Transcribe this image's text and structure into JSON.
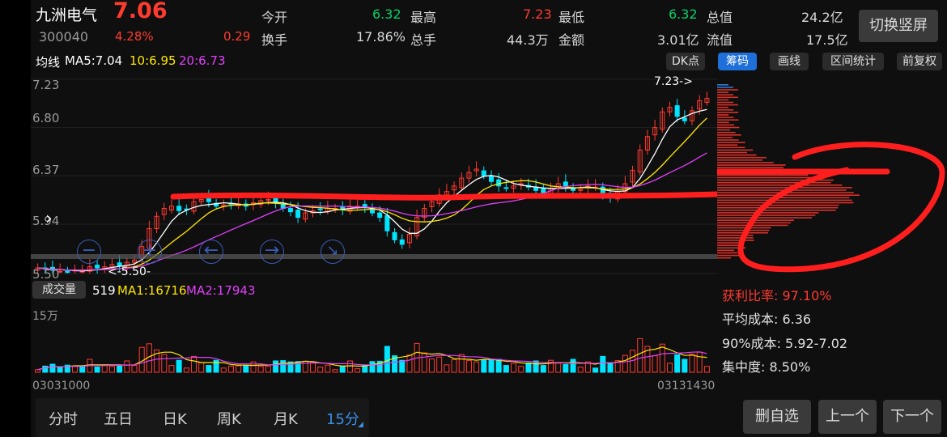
{
  "header": {
    "stock_name": "九洲电气",
    "price": "7.06",
    "code": "300040",
    "change_pct": "4.28%",
    "change_amt": "0.29",
    "open_label": "今开",
    "open_value": "6.32",
    "high_label": "最高",
    "high_value": "7.23",
    "low_label": "最低",
    "low_value": "6.32",
    "mktcap_label": "总值",
    "mktcap_value": "24.2亿",
    "turnover_label": "换手",
    "turnover_value": "17.86%",
    "volume_label": "总手",
    "volume_value": "44.3万",
    "amount_label": "金额",
    "amount_value": "3.01亿",
    "float_label": "流值",
    "float_value": "17.5亿",
    "switch_label": "切换竖屏"
  },
  "ma_bar": {
    "label": "均线",
    "ma5": "MA5:7.04",
    "ma10": "10:6.95",
    "ma20": "20:6.73"
  },
  "toolbar": {
    "dk": "DK点",
    "chip": "筹码",
    "draw": "画线",
    "interval": "区间统计",
    "restore": "前复权"
  },
  "price_axis": [
    "7.23",
    "6.80",
    "6.37",
    "5.94",
    "5.50"
  ],
  "annotations": {
    "high_marker": "7.23->",
    "low_marker": "<-5.50-"
  },
  "volume_bar": {
    "button": "成交量",
    "value": "519",
    "ma1": "MA1:16716",
    "ma2": "MA2:17943",
    "axis_max": "15万"
  },
  "time_axis": {
    "start": "03031000",
    "end": "03131430"
  },
  "chip_stats": {
    "profit_ratio": "获利比率: 97.10%",
    "avg_cost": "平均成本: 6.36",
    "cost90": "90%成本: 5.92-7.02",
    "concentration": "集中度: 8.50%"
  },
  "tabs": [
    "分时",
    "五日",
    "日K",
    "周K",
    "月K",
    "15分"
  ],
  "actions": {
    "remove": "删自选",
    "prev": "上一个",
    "next": "下一个"
  },
  "colors": {
    "up": "#ff3b30",
    "down": "#00e5ff",
    "ma5": "#ffffff",
    "ma10": "#ffe600",
    "ma20": "#e040fb",
    "active_tab": "#3a8ee6"
  },
  "chart_data": {
    "type": "candlestick",
    "y_range": [
      5.5,
      7.23
    ],
    "closes": [
      5.55,
      5.54,
      5.53,
      5.52,
      5.51,
      5.53,
      5.52,
      5.56,
      5.55,
      5.56,
      5.58,
      5.57,
      5.6,
      5.62,
      5.74,
      5.9,
      6.01,
      6.08,
      6.1,
      6.06,
      6.07,
      6.14,
      6.16,
      6.14,
      6.1,
      6.11,
      6.12,
      6.12,
      6.1,
      6.13,
      6.15,
      6.16,
      6.13,
      6.08,
      6.05,
      6.0,
      6.04,
      6.06,
      6.07,
      6.08,
      6.08,
      6.07,
      6.1,
      6.1,
      6.09,
      6.04,
      6.0,
      5.88,
      5.8,
      5.76,
      5.85,
      6.0,
      6.08,
      6.14,
      6.2,
      6.23,
      6.28,
      6.35,
      6.4,
      6.43,
      6.37,
      6.32,
      6.28,
      6.26,
      6.28,
      6.3,
      6.27,
      6.24,
      6.22,
      6.26,
      6.3,
      6.28,
      6.24,
      6.25,
      6.28,
      6.27,
      6.2,
      6.18,
      6.23,
      6.3,
      6.42,
      6.6,
      6.72,
      6.8,
      6.94,
      6.98,
      6.9,
      6.86,
      6.95,
      7.04,
      7.06
    ]
  }
}
